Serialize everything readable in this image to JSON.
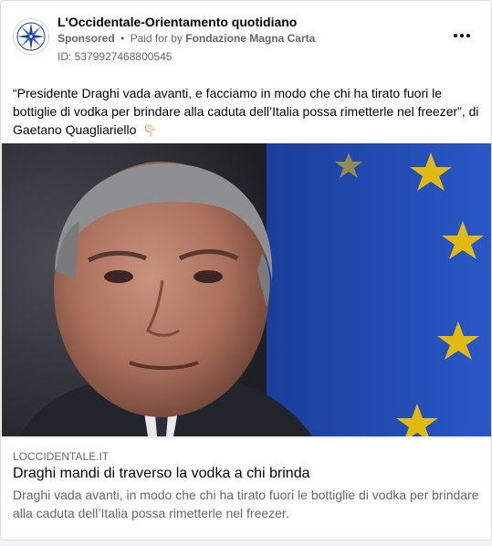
{
  "post": {
    "page_name": "L'Occidentale-Orientamento quotidiano",
    "sponsored_label": "Sponsored",
    "separator": "•",
    "paid_for_prefix": "Paid for by",
    "payer": "Fondazione Magna Carta",
    "ad_id": "ID: 5379927468800545",
    "text": "“Presidente Draghi vada avanti, e facciamo in modo che chi ha tirato fuori le bottiglie di vodka per brindare alla caduta dell’Italia possa rimetterle nel freezer”, di Gaetano Quagliariello",
    "text_emoji": "👇🏻",
    "more_options_icon": "more-horizontal-icon"
  },
  "link": {
    "domain": "LOCCIDENTALE.IT",
    "title": "Draghi mandi di traverso la vodka a chi brinda",
    "description": "Draghi vada avanti, in modo che chi ha tirato fuori le bottiglie di vodka per brindare alla caduta dell’Italia possa rimetterle nel freezer."
  },
  "colors": {
    "accent_blue": "#1b3f9c",
    "flag_blue": "#1f49b3",
    "star_yellow": "#f5c600",
    "secondary_text": "#65676b"
  }
}
